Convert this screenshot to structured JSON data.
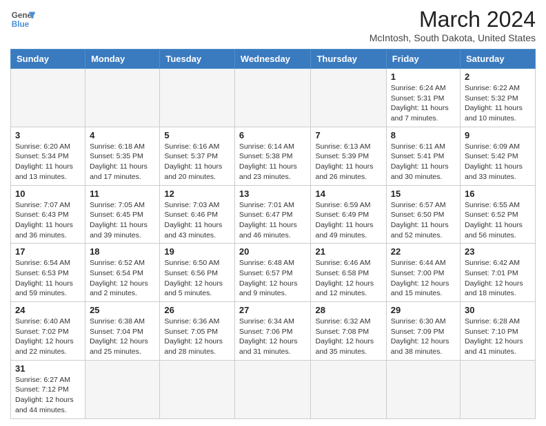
{
  "header": {
    "logo_general": "General",
    "logo_blue": "Blue",
    "month_title": "March 2024",
    "location": "McIntosh, South Dakota, United States"
  },
  "columns": [
    "Sunday",
    "Monday",
    "Tuesday",
    "Wednesday",
    "Thursday",
    "Friday",
    "Saturday"
  ],
  "weeks": [
    [
      {
        "day": "",
        "info": ""
      },
      {
        "day": "",
        "info": ""
      },
      {
        "day": "",
        "info": ""
      },
      {
        "day": "",
        "info": ""
      },
      {
        "day": "",
        "info": ""
      },
      {
        "day": "1",
        "info": "Sunrise: 6:24 AM\nSunset: 5:31 PM\nDaylight: 11 hours and 7 minutes."
      },
      {
        "day": "2",
        "info": "Sunrise: 6:22 AM\nSunset: 5:32 PM\nDaylight: 11 hours and 10 minutes."
      }
    ],
    [
      {
        "day": "3",
        "info": "Sunrise: 6:20 AM\nSunset: 5:34 PM\nDaylight: 11 hours and 13 minutes."
      },
      {
        "day": "4",
        "info": "Sunrise: 6:18 AM\nSunset: 5:35 PM\nDaylight: 11 hours and 17 minutes."
      },
      {
        "day": "5",
        "info": "Sunrise: 6:16 AM\nSunset: 5:37 PM\nDaylight: 11 hours and 20 minutes."
      },
      {
        "day": "6",
        "info": "Sunrise: 6:14 AM\nSunset: 5:38 PM\nDaylight: 11 hours and 23 minutes."
      },
      {
        "day": "7",
        "info": "Sunrise: 6:13 AM\nSunset: 5:39 PM\nDaylight: 11 hours and 26 minutes."
      },
      {
        "day": "8",
        "info": "Sunrise: 6:11 AM\nSunset: 5:41 PM\nDaylight: 11 hours and 30 minutes."
      },
      {
        "day": "9",
        "info": "Sunrise: 6:09 AM\nSunset: 5:42 PM\nDaylight: 11 hours and 33 minutes."
      }
    ],
    [
      {
        "day": "10",
        "info": "Sunrise: 7:07 AM\nSunset: 6:43 PM\nDaylight: 11 hours and 36 minutes."
      },
      {
        "day": "11",
        "info": "Sunrise: 7:05 AM\nSunset: 6:45 PM\nDaylight: 11 hours and 39 minutes."
      },
      {
        "day": "12",
        "info": "Sunrise: 7:03 AM\nSunset: 6:46 PM\nDaylight: 11 hours and 43 minutes."
      },
      {
        "day": "13",
        "info": "Sunrise: 7:01 AM\nSunset: 6:47 PM\nDaylight: 11 hours and 46 minutes."
      },
      {
        "day": "14",
        "info": "Sunrise: 6:59 AM\nSunset: 6:49 PM\nDaylight: 11 hours and 49 minutes."
      },
      {
        "day": "15",
        "info": "Sunrise: 6:57 AM\nSunset: 6:50 PM\nDaylight: 11 hours and 52 minutes."
      },
      {
        "day": "16",
        "info": "Sunrise: 6:55 AM\nSunset: 6:52 PM\nDaylight: 11 hours and 56 minutes."
      }
    ],
    [
      {
        "day": "17",
        "info": "Sunrise: 6:54 AM\nSunset: 6:53 PM\nDaylight: 11 hours and 59 minutes."
      },
      {
        "day": "18",
        "info": "Sunrise: 6:52 AM\nSunset: 6:54 PM\nDaylight: 12 hours and 2 minutes."
      },
      {
        "day": "19",
        "info": "Sunrise: 6:50 AM\nSunset: 6:56 PM\nDaylight: 12 hours and 5 minutes."
      },
      {
        "day": "20",
        "info": "Sunrise: 6:48 AM\nSunset: 6:57 PM\nDaylight: 12 hours and 9 minutes."
      },
      {
        "day": "21",
        "info": "Sunrise: 6:46 AM\nSunset: 6:58 PM\nDaylight: 12 hours and 12 minutes."
      },
      {
        "day": "22",
        "info": "Sunrise: 6:44 AM\nSunset: 7:00 PM\nDaylight: 12 hours and 15 minutes."
      },
      {
        "day": "23",
        "info": "Sunrise: 6:42 AM\nSunset: 7:01 PM\nDaylight: 12 hours and 18 minutes."
      }
    ],
    [
      {
        "day": "24",
        "info": "Sunrise: 6:40 AM\nSunset: 7:02 PM\nDaylight: 12 hours and 22 minutes."
      },
      {
        "day": "25",
        "info": "Sunrise: 6:38 AM\nSunset: 7:04 PM\nDaylight: 12 hours and 25 minutes."
      },
      {
        "day": "26",
        "info": "Sunrise: 6:36 AM\nSunset: 7:05 PM\nDaylight: 12 hours and 28 minutes."
      },
      {
        "day": "27",
        "info": "Sunrise: 6:34 AM\nSunset: 7:06 PM\nDaylight: 12 hours and 31 minutes."
      },
      {
        "day": "28",
        "info": "Sunrise: 6:32 AM\nSunset: 7:08 PM\nDaylight: 12 hours and 35 minutes."
      },
      {
        "day": "29",
        "info": "Sunrise: 6:30 AM\nSunset: 7:09 PM\nDaylight: 12 hours and 38 minutes."
      },
      {
        "day": "30",
        "info": "Sunrise: 6:28 AM\nSunset: 7:10 PM\nDaylight: 12 hours and 41 minutes."
      }
    ],
    [
      {
        "day": "31",
        "info": "Sunrise: 6:27 AM\nSunset: 7:12 PM\nDaylight: 12 hours and 44 minutes."
      },
      {
        "day": "",
        "info": ""
      },
      {
        "day": "",
        "info": ""
      },
      {
        "day": "",
        "info": ""
      },
      {
        "day": "",
        "info": ""
      },
      {
        "day": "",
        "info": ""
      },
      {
        "day": "",
        "info": ""
      }
    ]
  ]
}
